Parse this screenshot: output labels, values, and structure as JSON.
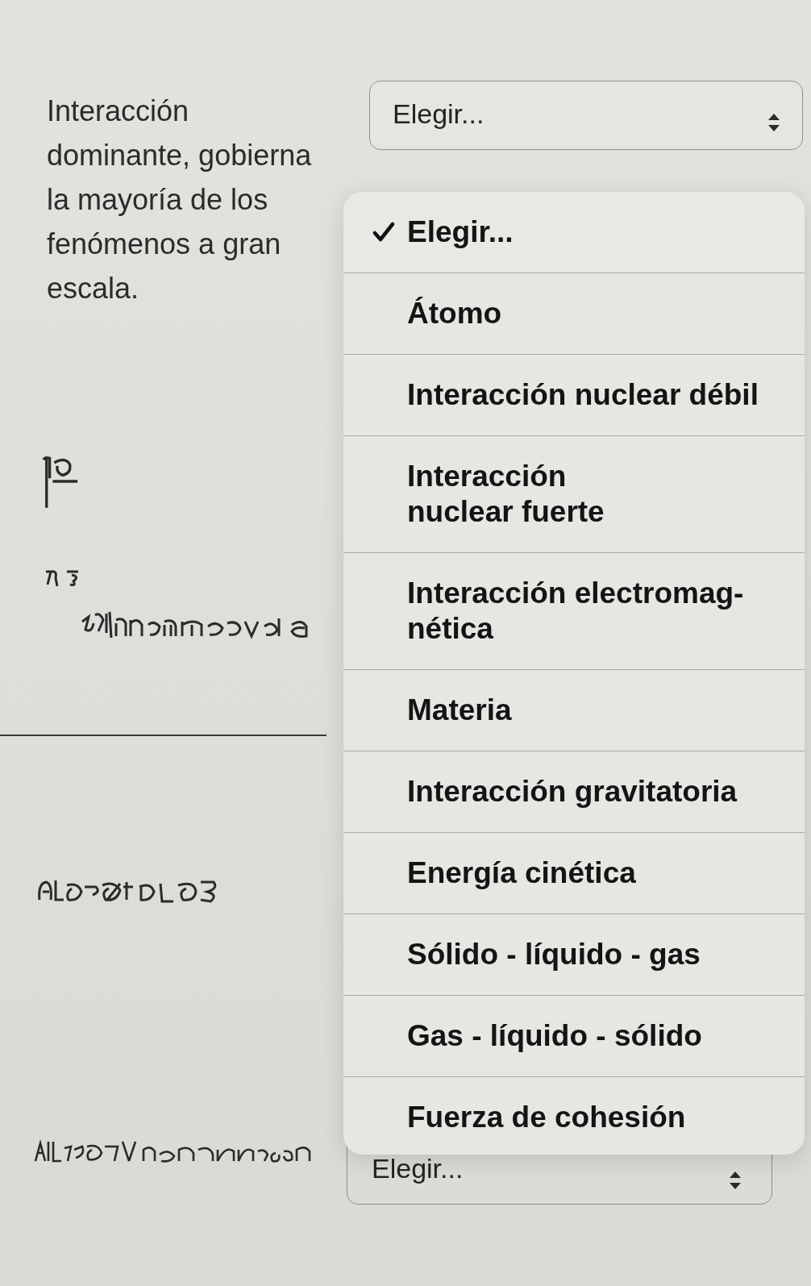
{
  "questions": [
    {
      "prompt": "Interacción dominante, gobierna la mayoría de los fenómenos a gran escala.",
      "select": {
        "value": "Elegir..."
      }
    },
    {
      "select": {
        "value": "Elegir..."
      }
    }
  ],
  "menu": {
    "options": [
      {
        "label": "Elegir...",
        "selected": true
      },
      {
        "label": "Átomo",
        "selected": false
      },
      {
        "label": "Interacción nuclear débil",
        "selected": false
      },
      {
        "label": "Interacción nuclear fuerte",
        "selected": false
      },
      {
        "label": "Interacción electromag-nética",
        "selected": false
      },
      {
        "label": "Materia",
        "selected": false
      },
      {
        "label": "Interacción gravitatoria",
        "selected": false
      },
      {
        "label": "Energía cinética",
        "selected": false
      },
      {
        "label": "Sólido - líquido - gas",
        "selected": false
      },
      {
        "label": "Gas - líquido - sólido",
        "selected": false
      },
      {
        "label": "Fuerza de cohesión",
        "selected": false
      }
    ]
  }
}
